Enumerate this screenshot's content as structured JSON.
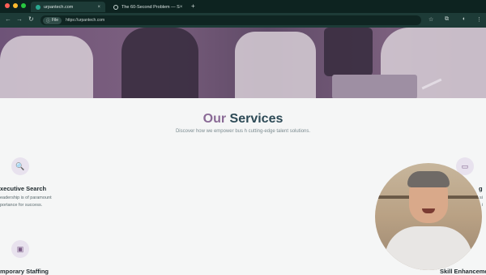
{
  "browser": {
    "tabs": [
      {
        "title": "urpantech.com",
        "close": "×"
      },
      {
        "title": "The 60-Second Problem — S",
        "close": "×"
      }
    ],
    "new_tab": "+",
    "nav": {
      "back": "←",
      "forward": "→",
      "reload": "↻"
    },
    "address": {
      "chip_label": "File",
      "url": "https://urpantech.com"
    },
    "toolbar_icons": {
      "star": "☆",
      "extensions": "⧉",
      "profile": "◐",
      "menu": "⋮"
    }
  },
  "hero": {},
  "services": {
    "title_first": "Our",
    "title_rest": "Services",
    "subtitle": "Discover how we empower bus           h cutting-edge talent solutions.",
    "items": [
      {
        "title": "xecutive Search",
        "desc_lines": [
          "eadership is of paramount",
          "portance for success."
        ],
        "icon": "search-icon",
        "glyph": "🔍"
      },
      {
        "title": "g",
        "desc_lines": [
          "si",
          "i"
        ],
        "icon": "laptop-icon",
        "glyph": "▭"
      },
      {
        "title": "mporary Staffing",
        "desc_lines": [],
        "icon": "id-card-icon",
        "glyph": "▣"
      },
      {
        "title": "Skill Enhanceme",
        "desc_lines": [],
        "icon": "",
        "glyph": ""
      }
    ]
  },
  "colors": {
    "browser_bg": "#0f2a27",
    "accent": "#8a6a96",
    "heading": "#2d4a56"
  }
}
